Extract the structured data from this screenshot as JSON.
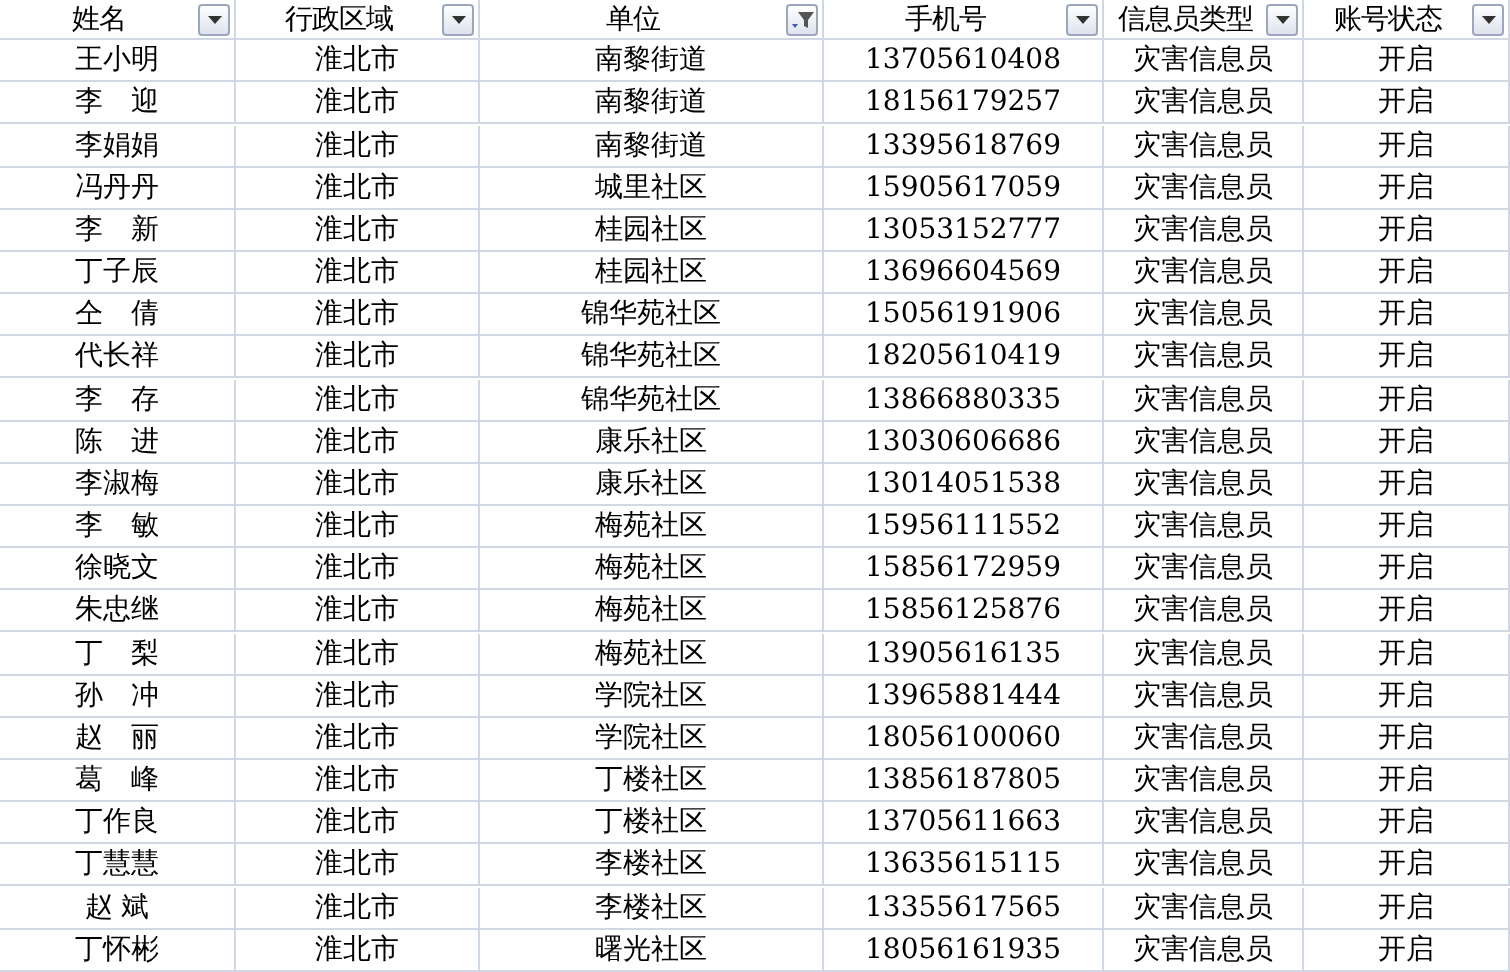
{
  "table": {
    "columns": [
      {
        "label": "姓名",
        "filtered": false
      },
      {
        "label": "行政区域",
        "filtered": false
      },
      {
        "label": "单位",
        "filtered": true
      },
      {
        "label": "手机号",
        "filtered": false
      },
      {
        "label": "信息员类型",
        "filtered": false
      },
      {
        "label": "账号状态",
        "filtered": false
      }
    ],
    "rows": [
      [
        "王小明",
        "淮北市",
        "南黎街道",
        "13705610408",
        "灾害信息员",
        "开启"
      ],
      [
        "李　迎",
        "淮北市",
        "南黎街道",
        "18156179257",
        "灾害信息员",
        "开启"
      ],
      [
        "李娟娟",
        "淮北市",
        "南黎街道",
        "13395618769",
        "灾害信息员",
        "开启"
      ],
      [
        "冯丹丹",
        "淮北市",
        "城里社区",
        "15905617059",
        "灾害信息员",
        "开启"
      ],
      [
        "李　新",
        "淮北市",
        "桂园社区",
        "13053152777",
        "灾害信息员",
        "开启"
      ],
      [
        "丁子辰",
        "淮北市",
        "桂园社区",
        "13696604569",
        "灾害信息员",
        "开启"
      ],
      [
        "仝　倩",
        "淮北市",
        "锦华苑社区",
        "15056191906",
        "灾害信息员",
        "开启"
      ],
      [
        "代长祥",
        "淮北市",
        "锦华苑社区",
        "18205610419",
        "灾害信息员",
        "开启"
      ],
      [
        "李　存",
        "淮北市",
        "锦华苑社区",
        "13866880335",
        "灾害信息员",
        "开启"
      ],
      [
        "陈　进",
        "淮北市",
        "康乐社区",
        "13030606686",
        "灾害信息员",
        "开启"
      ],
      [
        "李淑梅",
        "淮北市",
        "康乐社区",
        "13014051538",
        "灾害信息员",
        "开启"
      ],
      [
        "李　敏",
        "淮北市",
        "梅苑社区",
        "15956111552",
        "灾害信息员",
        "开启"
      ],
      [
        "徐晓文",
        "淮北市",
        "梅苑社区",
        "15856172959",
        "灾害信息员",
        "开启"
      ],
      [
        "朱忠继",
        "淮北市",
        "梅苑社区",
        "15856125876",
        "灾害信息员",
        "开启"
      ],
      [
        "丁　梨",
        "淮北市",
        "梅苑社区",
        "13905616135",
        "灾害信息员",
        "开启"
      ],
      [
        "孙　冲",
        "淮北市",
        "学院社区",
        "13965881444",
        "灾害信息员",
        "开启"
      ],
      [
        "赵　丽",
        "淮北市",
        "学院社区",
        "18056100060",
        "灾害信息员",
        "开启"
      ],
      [
        "葛　峰",
        "淮北市",
        "丁楼社区",
        "13856187805",
        "灾害信息员",
        "开启"
      ],
      [
        "丁作良",
        "淮北市",
        "丁楼社区",
        "13705611663",
        "灾害信息员",
        "开启"
      ],
      [
        "丁慧慧",
        "淮北市",
        "李楼社区",
        "13635615115",
        "灾害信息员",
        "开启"
      ],
      [
        "赵 斌",
        "淮北市",
        "李楼社区",
        "13355617565",
        "灾害信息员",
        "开启"
      ],
      [
        "丁怀彬",
        "淮北市",
        "曙光社区",
        "18056161935",
        "灾害信息员",
        "开启"
      ]
    ]
  }
}
